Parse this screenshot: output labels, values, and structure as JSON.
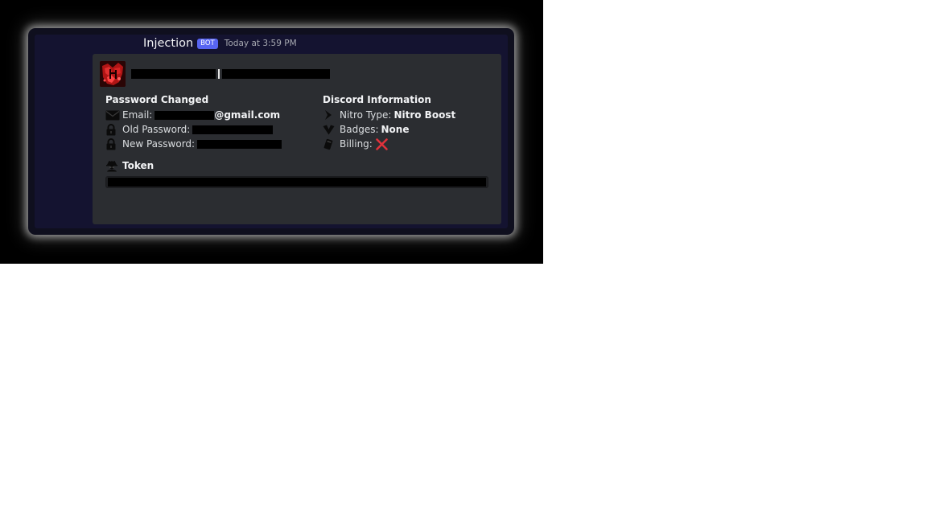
{
  "message": {
    "username": "Injection",
    "bot_tag": "BOT",
    "timestamp": "Today at 3:59 PM"
  },
  "embed": {
    "colors": {
      "embed_background": "#2b2d31",
      "bot_tag": "#5865f2",
      "billing_icon": "#e0323b"
    },
    "password_section": {
      "title": "Password Changed",
      "email_label": "Email:",
      "email_suffix": "@gmail.com",
      "old_password_label": "Old Password:",
      "new_password_label": "New Password:",
      "icons": [
        "envelope-icon",
        "lock-icon",
        "lock-icon"
      ]
    },
    "discord_section": {
      "title": "Discord Information",
      "nitro_label": "Nitro Type:",
      "nitro_value": "Nitro Boost",
      "badges_label": "Badges:",
      "badges_value": "None",
      "billing_label": "Billing:",
      "billing_value_icon": "red-x-icon",
      "icons": [
        "nitro-boost-icon",
        "badge-icon",
        "card-icon"
      ]
    },
    "token_section": {
      "title": "Token",
      "icon": "spy-icon"
    }
  }
}
